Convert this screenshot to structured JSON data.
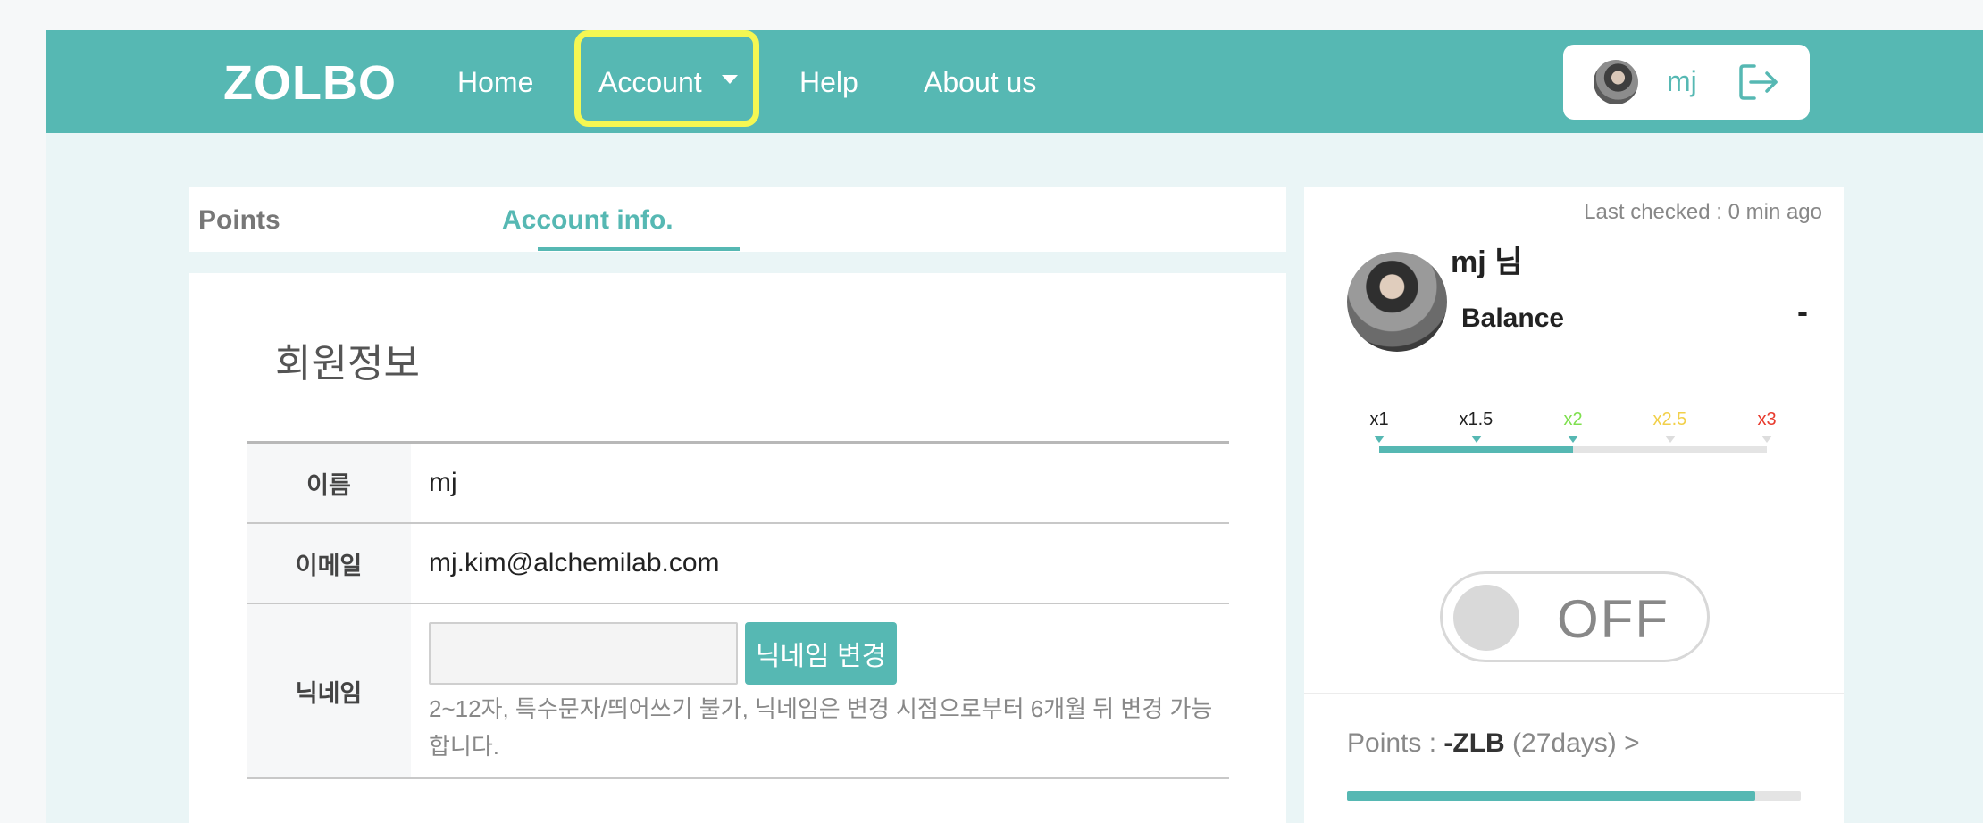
{
  "navbar": {
    "brand": "ZOLBO",
    "links": {
      "home": "Home",
      "account": "Account",
      "help": "Help",
      "about": "About us"
    },
    "user": {
      "name": "mj"
    }
  },
  "tabs": {
    "points": "Points",
    "account_info": "Account info."
  },
  "account": {
    "title": "회원정보",
    "rows": {
      "name": {
        "label": "이름",
        "value": "mj"
      },
      "email": {
        "label": "이메일",
        "value": "mj.kim@alchemilab.com"
      },
      "nickname": {
        "label": "닉네임",
        "input_value": "",
        "button": "닉네임 변경",
        "help": "2~12자, 특수문자/띄어쓰기 불가, 닉네임은 변경 시점으로부터 6개월 뒤 변경 가능합니다."
      }
    }
  },
  "side": {
    "last_checked": "Last checked : 0 min ago",
    "greeting": "mj 님",
    "balance_label": "Balance",
    "balance_value": "-",
    "multipliers": [
      {
        "label": "x1",
        "color": "#222222",
        "active": true
      },
      {
        "label": "x1.5",
        "color": "#222222",
        "active": true
      },
      {
        "label": "x2",
        "color": "#7fe04f",
        "active": true
      },
      {
        "label": "x2.5",
        "color": "#f2d04a",
        "active": false
      },
      {
        "label": "x3",
        "color": "#e83b2e",
        "active": false
      }
    ],
    "multiplier_progress": 0.5,
    "toggle_label": "OFF",
    "points": {
      "prefix": "Points : ",
      "value": "-ZLB",
      "suffix": " (27days) >"
    },
    "points_progress": 0.9
  },
  "colors": {
    "accent": "#56b8b3",
    "highlight": "#f4f752"
  }
}
